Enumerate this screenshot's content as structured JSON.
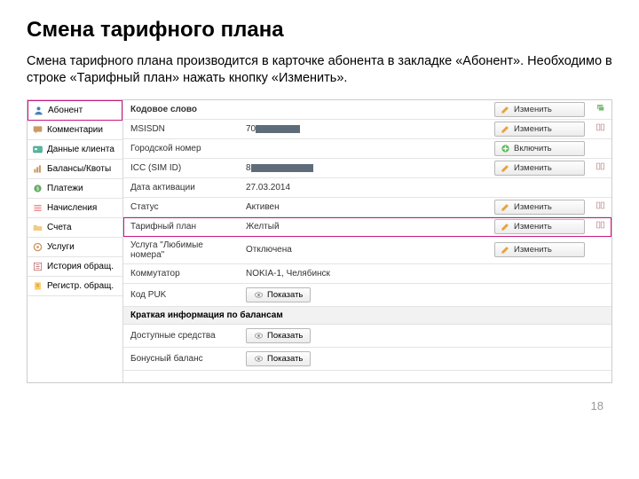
{
  "title": "Смена тарифного плана",
  "description": "Смена тарифного плана производится в карточке абонента в закладке «Абонент». Необходимо в строке «Тарифный план» нажать кнопку «Изменить».",
  "sidebar": {
    "items": [
      {
        "label": "Абонент",
        "icon": "person",
        "active": true
      },
      {
        "label": "Комментарии",
        "icon": "comment"
      },
      {
        "label": "Данные клиента",
        "icon": "card"
      },
      {
        "label": "Балансы/Квоты",
        "icon": "balance"
      },
      {
        "label": "Платежи",
        "icon": "payment"
      },
      {
        "label": "Начисления",
        "icon": "list"
      },
      {
        "label": "Счета",
        "icon": "folder"
      },
      {
        "label": "Услуги",
        "icon": "service"
      },
      {
        "label": "История обращ.",
        "icon": "history"
      },
      {
        "label": "Регистр. обращ.",
        "icon": "register"
      }
    ]
  },
  "rows": [
    {
      "label": "Кодовое слово",
      "value": "",
      "action": "Изменить",
      "actionIcon": "edit",
      "extra": "cards",
      "bold": true
    },
    {
      "label": "MSISDN",
      "value": "70",
      "redacted": true,
      "action": "Изменить",
      "actionIcon": "edit",
      "extra": "book"
    },
    {
      "label": "Городской номер",
      "value": "",
      "action": "Включить",
      "actionIcon": "add"
    },
    {
      "label": "ICC (SIM ID)",
      "value": "8",
      "redacted2": true,
      "action": "Изменить",
      "actionIcon": "edit",
      "extra": "book"
    },
    {
      "label": "Дата активации",
      "value": "27.03.2014"
    },
    {
      "label": "Статус",
      "value": "Активен",
      "action": "Изменить",
      "actionIcon": "edit",
      "extra": "book"
    },
    {
      "label": "Тарифный план",
      "value": "Желтый",
      "action": "Изменить",
      "actionIcon": "edit",
      "extra": "book",
      "highlight": true
    },
    {
      "label": "Услуга \"Любимые номера\"",
      "value": "Отключена",
      "action": "Изменить",
      "actionIcon": "edit"
    },
    {
      "label": "Коммутатор",
      "value": "NOKIA-1, Челябинск"
    },
    {
      "label": "Код PUK",
      "value": "",
      "show": true
    }
  ],
  "section_header": "Краткая информация по балансам",
  "balance_rows": [
    {
      "label": "Доступные средства",
      "show": true
    },
    {
      "label": "Бонусный баланс",
      "show": true
    }
  ],
  "btn_show": "Показать",
  "page_number": "18"
}
